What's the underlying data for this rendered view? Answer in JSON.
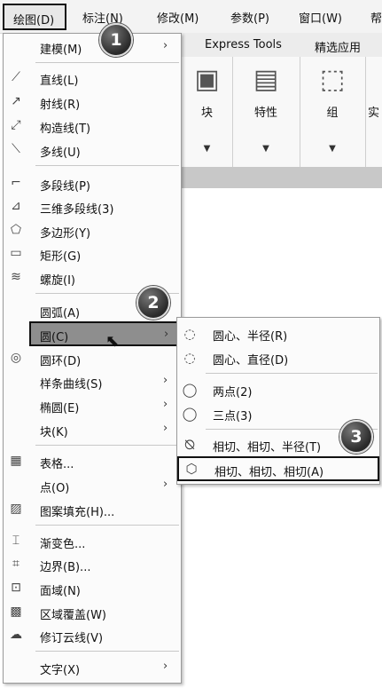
{
  "menubar": {
    "items": [
      "绘图(D)",
      "标注(N)",
      "修改(M)",
      "参数(P)",
      "窗口(W)",
      "帮"
    ]
  },
  "ribbon": {
    "tabs": [
      "Express Tools",
      "精选应用"
    ],
    "groups": [
      "块",
      "特性",
      "组",
      "实"
    ]
  },
  "draw_menu": {
    "items": [
      {
        "label": "建模(M)",
        "submenu": true
      },
      {
        "label": "直线(L)",
        "icon": "line-icon"
      },
      {
        "label": "射线(R)",
        "icon": "ray-icon"
      },
      {
        "label": "构造线(T)",
        "icon": "construction-line-icon"
      },
      {
        "label": "多线(U)",
        "icon": "multiline-icon"
      },
      {
        "label": "多段线(P)",
        "icon": "polyline-icon"
      },
      {
        "label": "三维多段线(3)",
        "icon": "3d-polyline-icon"
      },
      {
        "label": "多边形(Y)",
        "icon": "polygon-icon"
      },
      {
        "label": "矩形(G)",
        "icon": "rectangle-icon"
      },
      {
        "label": "螺旋(I)",
        "icon": "helix-icon"
      },
      {
        "label": "圆弧(A)",
        "submenu": true
      },
      {
        "label": "圆(C)",
        "submenu": true,
        "highlighted": true
      },
      {
        "label": "圆环(D)",
        "icon": "donut-icon"
      },
      {
        "label": "样条曲线(S)",
        "submenu": true
      },
      {
        "label": "椭圆(E)",
        "submenu": true
      },
      {
        "label": "块(K)",
        "submenu": true
      },
      {
        "label": "表格...",
        "icon": "table-icon"
      },
      {
        "label": "点(O)",
        "submenu": true
      },
      {
        "label": "图案填充(H)...",
        "icon": "hatch-icon"
      },
      {
        "label": "渐变色...",
        "icon": "gradient-icon"
      },
      {
        "label": "边界(B)...",
        "icon": "boundary-icon"
      },
      {
        "label": "面域(N)",
        "icon": "region-icon"
      },
      {
        "label": "区域覆盖(W)",
        "icon": "wipeout-icon"
      },
      {
        "label": "修订云线(V)",
        "icon": "revision-cloud-icon"
      },
      {
        "label": "文字(X)",
        "submenu": true
      }
    ]
  },
  "circle_submenu": {
    "items": [
      {
        "label": "圆心、半径(R)",
        "icon": "center-radius-icon"
      },
      {
        "label": "圆心、直径(D)",
        "icon": "center-diameter-icon"
      },
      {
        "label": "两点(2)",
        "icon": "two-point-icon"
      },
      {
        "label": "三点(3)",
        "icon": "three-point-icon"
      },
      {
        "label": "相切、相切、半径(T)",
        "icon": "tan-tan-radius-icon"
      },
      {
        "label": "相切、相切、相切(A)",
        "icon": "tan-tan-tan-icon",
        "highlighted": true
      }
    ]
  },
  "callouts": [
    "1",
    "2",
    "3"
  ],
  "colors": {
    "highlight": "#8e8e8e",
    "menu_bg": "#fbfbfb",
    "badge": "#2a2a2a"
  }
}
